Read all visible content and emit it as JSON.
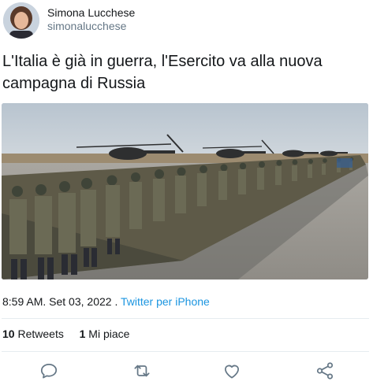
{
  "user": {
    "display_name": "Simona Lucchese",
    "handle": "simonalucchese"
  },
  "tweet": {
    "text": "L'Italia è già in guerra, l'Esercito va alla nuova campagna di Russia",
    "time": "8:59 AM.",
    "date": "Set 03, 2022",
    "separator": ".",
    "source": "Twitter per iPhone"
  },
  "stats": {
    "retweets_count": "10",
    "retweets_label": "Retweets",
    "likes_count": "1",
    "likes_label": "Mi piace"
  },
  "actions": {
    "icons": [
      "reply-icon",
      "retweet-icon",
      "like-icon",
      "share-icon"
    ]
  },
  "colors": {
    "text": "#14171a",
    "secondary": "#657786",
    "link": "#1b95e0",
    "divider": "#e6ecf0",
    "icon": "#657786"
  }
}
